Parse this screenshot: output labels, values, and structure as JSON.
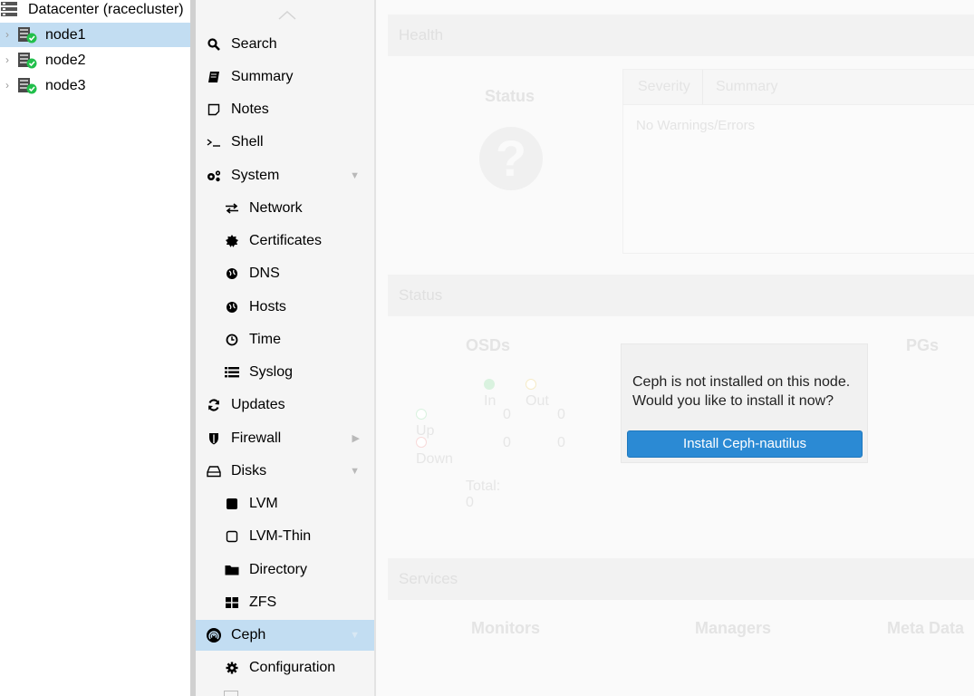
{
  "tree": {
    "datacenter_label": "Datacenter (racecluster)",
    "nodes": [
      {
        "label": "node1",
        "selected": true
      },
      {
        "label": "node2",
        "selected": false
      },
      {
        "label": "node3",
        "selected": false
      }
    ]
  },
  "menu": {
    "items": [
      {
        "label": "Search",
        "icon": "search-icon"
      },
      {
        "label": "Summary",
        "icon": "book-icon"
      },
      {
        "label": "Notes",
        "icon": "note-icon"
      },
      {
        "label": "Shell",
        "icon": "terminal-icon"
      },
      {
        "label": "System",
        "icon": "cogs-icon",
        "expanded": true
      },
      {
        "label": "Network",
        "icon": "exchange-icon"
      },
      {
        "label": "Certificates",
        "icon": "certificate-icon"
      },
      {
        "label": "DNS",
        "icon": "globe-icon"
      },
      {
        "label": "Hosts",
        "icon": "globe-icon"
      },
      {
        "label": "Time",
        "icon": "clock-icon"
      },
      {
        "label": "Syslog",
        "icon": "list-icon"
      },
      {
        "label": "Updates",
        "icon": "refresh-icon"
      },
      {
        "label": "Firewall",
        "icon": "shield-icon",
        "collapsed": true
      },
      {
        "label": "Disks",
        "icon": "hdd-icon",
        "expanded": true
      },
      {
        "label": "LVM",
        "icon": "square-icon"
      },
      {
        "label": "LVM-Thin",
        "icon": "square-outline-icon"
      },
      {
        "label": "Directory",
        "icon": "folder-icon"
      },
      {
        "label": "ZFS",
        "icon": "th-large-icon"
      },
      {
        "label": "Ceph",
        "icon": "ceph-icon",
        "expanded": true,
        "selected": true
      },
      {
        "label": "Configuration",
        "icon": "gear-icon"
      }
    ]
  },
  "health": {
    "header": "Health",
    "status_label": "Status",
    "grid_columns": [
      "Severity",
      "Summary"
    ],
    "empty_text": "No Warnings/Errors"
  },
  "status": {
    "header": "Status",
    "osds_title": "OSDs",
    "pgs_title": "PGs",
    "col_in": "In",
    "col_out": "Out",
    "row_up": "Up",
    "row_down": "Down",
    "up_in": "0",
    "up_out": "0",
    "down_in": "0",
    "down_out": "0",
    "total": "Total: 0"
  },
  "services": {
    "header": "Services",
    "monitors": "Monitors",
    "managers": "Managers",
    "metadata": "Meta Data"
  },
  "dialog": {
    "message_line1": "Ceph is not installed on this node.",
    "message_line2": "Would you like to install it now?",
    "button_label": "Install Ceph-nautilus"
  },
  "colors": {
    "selection": "#c2ddf2",
    "button": "#2b8ad4",
    "status_ok": "#21bf4b"
  }
}
